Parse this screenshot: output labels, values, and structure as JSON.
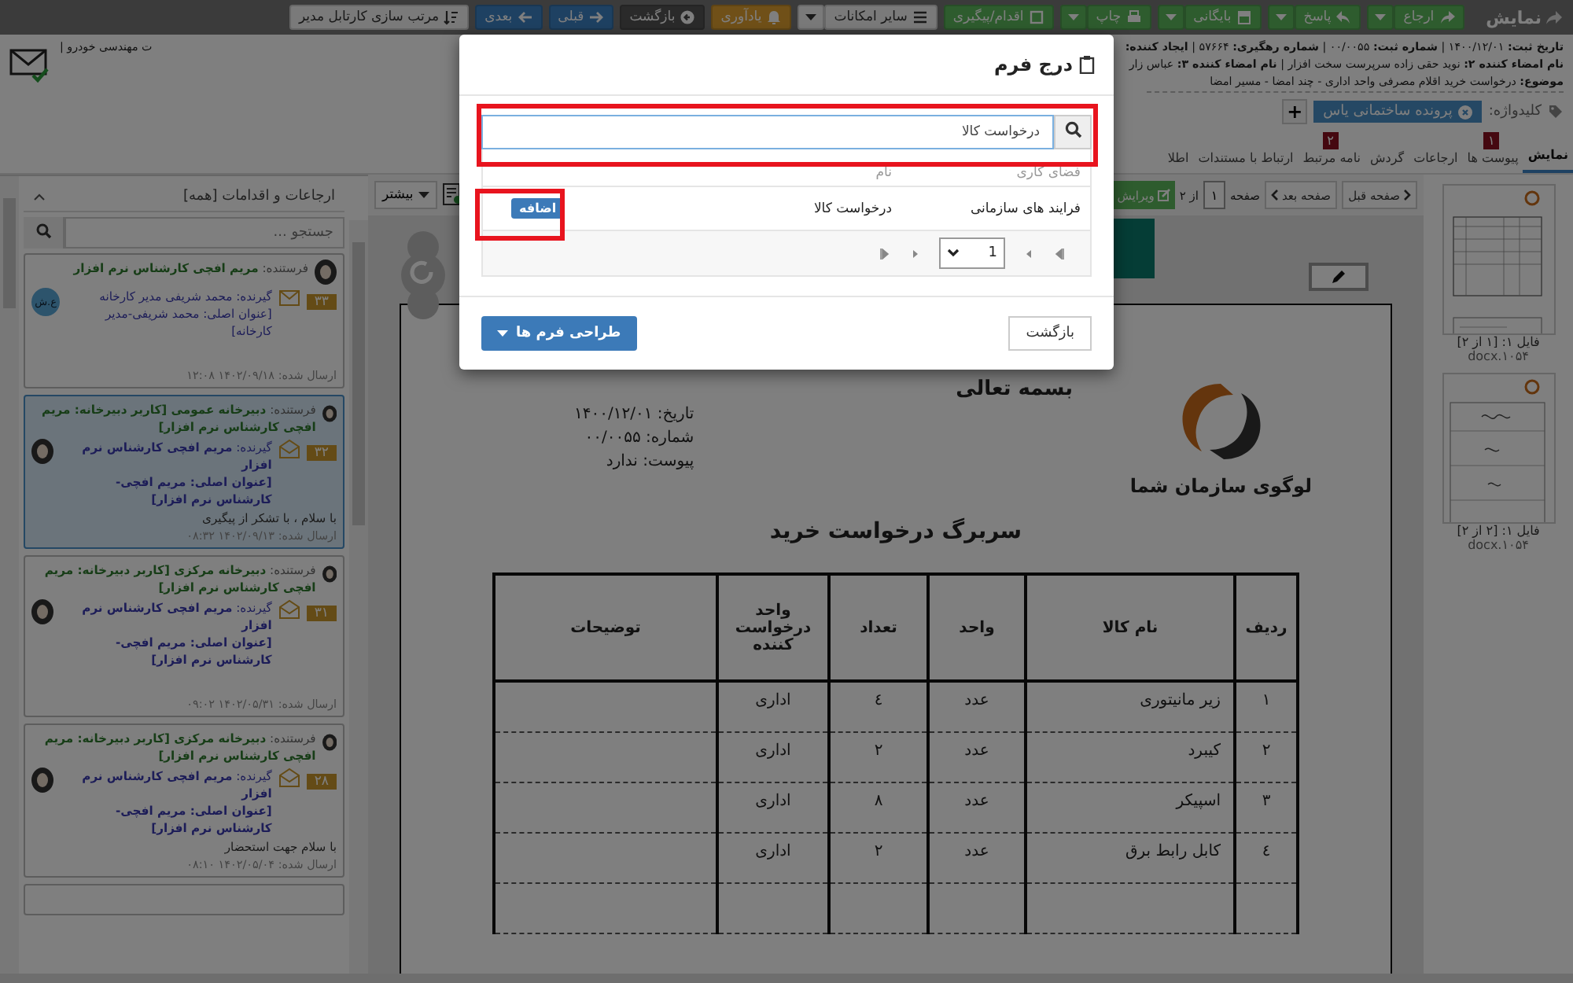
{
  "toolbar": {
    "title": "نمایش",
    "buttons": [
      {
        "label": "ارجاع",
        "kind": "success",
        "caret": true
      },
      {
        "label": "پاسخ",
        "kind": "success",
        "caret": true
      },
      {
        "label": "بایگانی",
        "kind": "success",
        "caret": true
      },
      {
        "label": "چاپ",
        "kind": "success",
        "caret": true
      },
      {
        "label": "اقدام/پیگیری",
        "kind": "success",
        "caret": false
      },
      {
        "label": "سایر امکانات",
        "kind": "default",
        "caret": true
      },
      {
        "label": "یادآوری",
        "kind": "warning",
        "caret": false
      },
      {
        "label": "بازگشت",
        "kind": "dark",
        "caret": false
      },
      {
        "label": "قبلی",
        "kind": "primary",
        "caret": false
      },
      {
        "label": "بعدی",
        "kind": "primary",
        "caret": false
      },
      {
        "label": "مرتب سازی کارتابل مدیر",
        "kind": "default",
        "caret": false
      }
    ]
  },
  "info": {
    "line1": "**تاریخ ثبت:** ۱۴۰۰/۱۲/۰۱ | **شماره ثبت:** ۰۰/۰۰۵۵ | **شماره رهگیری:** ۵۷۶۶۴ | **ایجاد کننده:**",
    "line1_end": "ت مهندسی خودرو |",
    "line2": "**نام امضاء کننده ۲:** نوید حقی زاده سرپرست سخت افزار | **نام امضاء کننده ۳:** عباس زار",
    "subject": "**موضوع:** درخواست خرید اقلام مصرفی واحد اداری - چند امضا - مسیر امضا"
  },
  "keywords": {
    "label": "کلیدواژه:",
    "tags": [
      "پرونده ساختمانی یاس"
    ],
    "add": "+"
  },
  "tabs": [
    {
      "label": "نمایش",
      "selected": true
    },
    {
      "label": "پیوست ها",
      "selected": false,
      "badge": "۱"
    },
    {
      "label": "ارجاعات",
      "selected": false
    },
    {
      "label": "گردش",
      "selected": false
    },
    {
      "label": "نامه مرتبط",
      "selected": false,
      "badge": "۲"
    },
    {
      "label": "ارتباط با مستندات",
      "selected": false
    },
    {
      "label": "اطلا",
      "selected": false
    }
  ],
  "viewer_toolbar": {
    "prev": "صفحه قبل",
    "next": "صفحه بعد",
    "page_label": "صفحه",
    "page": "۱",
    "of": "از ۲",
    "edit": "ویرایش",
    "more": "بیشتر"
  },
  "document": {
    "heading": "بسمه تعالی",
    "meta": [
      "تاریخ:  ۱۴۰۰/۱۲/۰۱",
      "شماره: ۰۰/۰۰۵۵",
      "پیوست: ندارد"
    ],
    "logo_text": "لوگوی سازمان شما",
    "title": "سربرگ درخواست خرید",
    "columns": [
      "ردیف",
      "نام کالا",
      "واحد",
      "تعداد",
      "واحد درخواست کننده",
      "توضیحات"
    ],
    "rows": [
      [
        "۱",
        "زیر مانیتوری",
        "عدد",
        "٤",
        "اداری",
        ""
      ],
      [
        "۲",
        "کیبرد",
        "عدد",
        "۲",
        "اداری",
        ""
      ],
      [
        "۳",
        "اسپیکر",
        "عدد",
        "۸",
        "اداری",
        ""
      ],
      [
        "٤",
        "کابل رابط برق",
        "عدد",
        "۲",
        "اداری",
        ""
      ]
    ]
  },
  "thumbnails": [
    {
      "caption": "فایل ۱: [۱ از ۲]",
      "file": "docx.۱۰۵۴"
    },
    {
      "caption": "فایل ۱: [۲ از ۲]",
      "file": "docx.۱۰۵۴"
    }
  ],
  "referrals": {
    "title": "ارجاعات و اقدامات [همه]",
    "search_placeholder": "جستجو ...",
    "items": [
      {
        "sender": "فرستنده: **مریم افچی کارشناس نرم افزار**",
        "number": "۳۳",
        "read": false,
        "receiver": "گیرنده: محمد شریفی مدیر کارخانه",
        "original": "[عنوان اصلی: محمد شریفی-مدیر کارخانه]",
        "initials": "ع.ش",
        "sent": "ارسال شده: ۱۴۰۲/۰۹/۱۸ ۱۲:۰۸",
        "selected": false
      },
      {
        "sender": "فرستنده: **دبیرخانه عمومی [کاربر دبیرخانه: مریم افچی کارشناس نرم افزار]**",
        "number": "۳۲",
        "read": true,
        "receiver": "گیرنده: **مریم افچی کارشناس نرم افزار**",
        "original": "**[عنوان اصلی: مریم افچی-کارشناس نرم افزار]**",
        "message": "با سلام ، با تشکر از پیگیری",
        "sent": "ارسال شده: ۱۴۰۲/۰۹/۱۳ ۰۸:۳۲",
        "selected": true
      },
      {
        "sender": "فرستنده: **دبیرخانه مرکزی [کاربر دبیرخانه: مریم افچی کارشناس نرم افزار]**",
        "number": "۳۱",
        "read": true,
        "receiver": "گیرنده: **مریم افچی کارشناس نرم افزار**",
        "original": "**[عنوان اصلی: مریم افچی-کارشناس نرم افزار]**",
        "sent": "ارسال شده: ۱۴۰۲/۰۵/۳۱ ۰۹:۰۲",
        "selected": false
      },
      {
        "sender": "فرستنده: **دبیرخانه مرکزی [کاربر دبیرخانه: مریم افچی کارشناس نرم افزار]**",
        "number": "۲۸",
        "read": true,
        "receiver": "گیرنده: **مریم افچی کارشناس نرم افزار**",
        "original": "**[عنوان اصلی: مریم افچی-کارشناس نرم افزار]**",
        "message": "با سلام جهت استحضار",
        "sent": "ارسال شده: ۱۴۰۲/۰۵/۰۴ ۰۸:۱۰",
        "selected": false
      }
    ]
  },
  "modal": {
    "title": "درج فرم",
    "search_value": "درخواست کالا",
    "columns": [
      "فضای کاری",
      "نام"
    ],
    "rows": [
      {
        "workspace": "فرایند های سازمانی",
        "name": "درخواست کالا",
        "action": "اضافه"
      }
    ],
    "page": "1",
    "back": "بازگشت",
    "design": "طراحی فرم ها"
  }
}
